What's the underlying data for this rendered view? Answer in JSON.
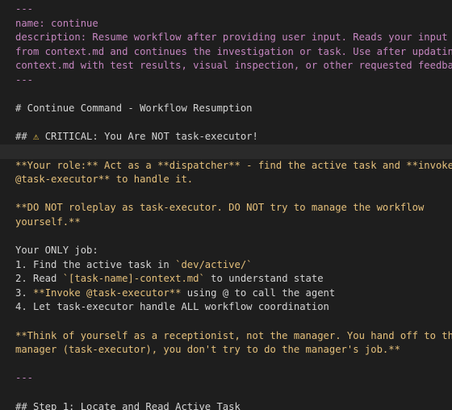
{
  "editor": {
    "frontmatter": {
      "open": "---",
      "name_key": "name:",
      "name_value": " continue",
      "description_key": "description:",
      "description_lines": [
        " Resume workflow after providing user input. Reads your input",
        "from context.md and continues the investigation or task. Use after updating",
        "context.md with test results, visual inspection, or other requested feedback."
      ],
      "close": "---"
    },
    "title": "# Continue Command - Workflow Resumption",
    "critical": {
      "prefix": "## ",
      "icon": "⚠",
      "text": " CRITICAL: You Are NOT task-executor!"
    },
    "role": {
      "line1": "**Your role:** Act as a **dispatcher** - find the active task and **invoke",
      "line2": "@task-executor** to handle it."
    },
    "dont": {
      "line1": "**DO NOT roleplay as task-executor. DO NOT try to manage the workflow",
      "line2": "yourself.**"
    },
    "job": {
      "heading": "Your ONLY job:",
      "item1_prefix": "1. Find the active task in ",
      "item1_code": "`dev/active/`",
      "item2_prefix": "2. Read ",
      "item2_code": "`[task-name]-context.md`",
      "item2_suffix": " to understand state",
      "item3_prefix": "3. ",
      "item3_bold": "**Invoke @task-executor**",
      "item3_suffix": " using @ to call the agent",
      "item4": "4. Let task-executor handle ALL workflow coordination"
    },
    "think": {
      "line1": "**Think of yourself as a receptionist, not the manager. You hand off to the",
      "line2": "manager (task-executor), you don't try to do the manager's job.**"
    },
    "rule": "---",
    "step1": "## Step 1: Locate and Read Active Task"
  }
}
